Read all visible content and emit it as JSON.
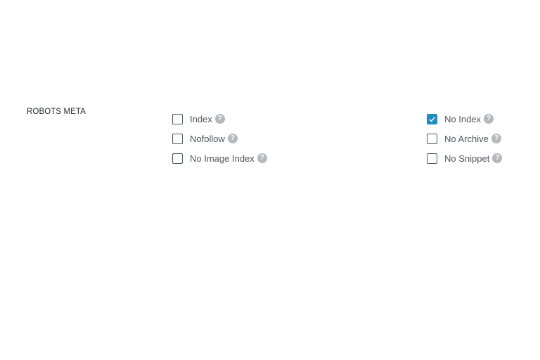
{
  "section": {
    "label": "ROBOTS META"
  },
  "options_left": [
    {
      "label": "Index",
      "checked": false,
      "help": "?"
    },
    {
      "label": "Nofollow",
      "checked": false,
      "help": "?"
    },
    {
      "label": "No Image Index",
      "checked": false,
      "help": "?"
    }
  ],
  "options_right": [
    {
      "label": "No Index",
      "checked": true,
      "help": "?"
    },
    {
      "label": "No Archive",
      "checked": false,
      "help": "?"
    },
    {
      "label": "No Snippet",
      "checked": false,
      "help": "?"
    }
  ],
  "colors": {
    "checkbox_checked": "#1e8cbe",
    "help_icon": "#b4b9be"
  }
}
